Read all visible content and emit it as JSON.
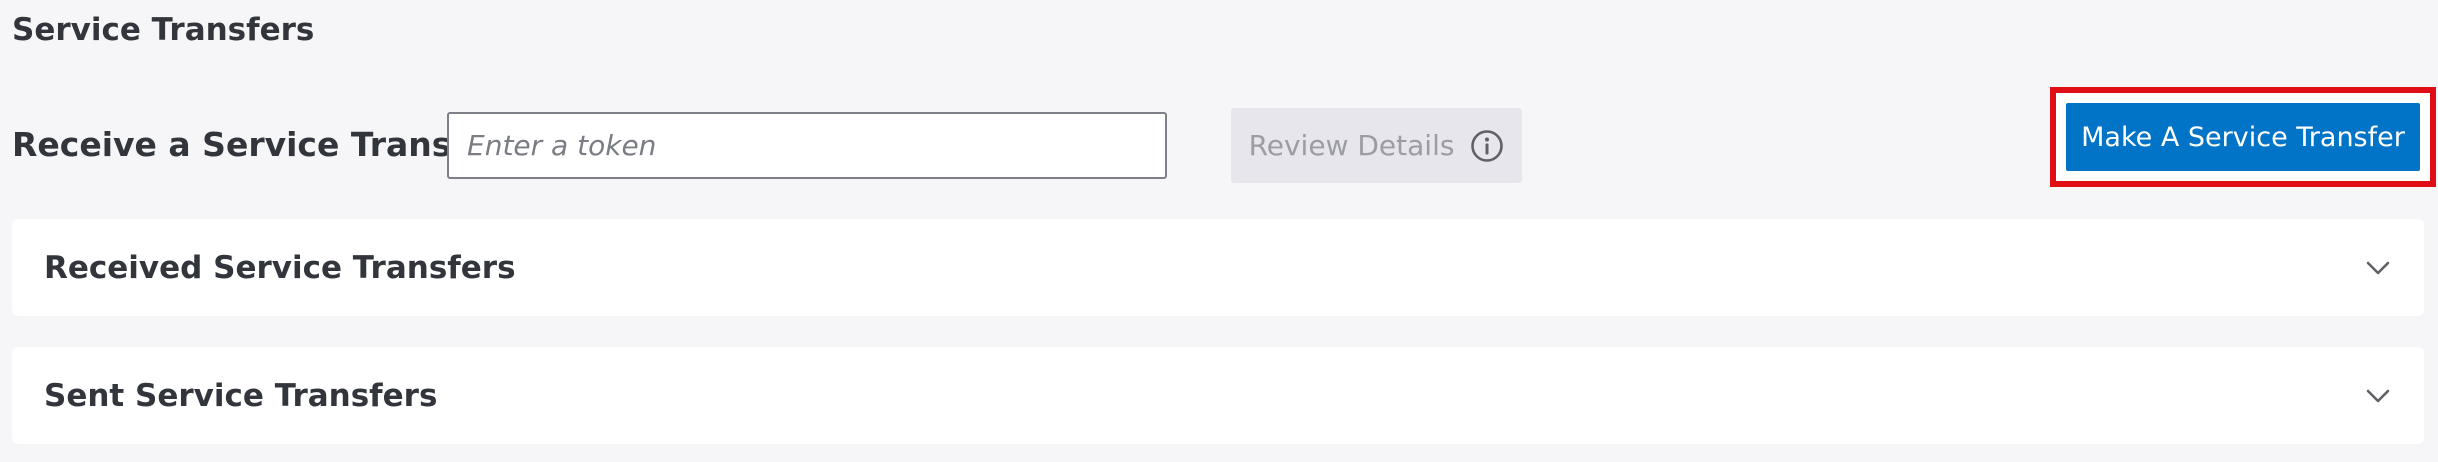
{
  "page": {
    "title": "Service Transfers"
  },
  "receive": {
    "label": "Receive a Service Transfer",
    "input_value": "",
    "input_placeholder": "Enter a token",
    "review_button_label": "Review Details",
    "review_button_icon": "info-icon"
  },
  "make": {
    "button_label": "Make A Service Transfer",
    "accent_color": "#0174c8",
    "highlight_color": "#e00d14"
  },
  "panels": [
    {
      "title": "Received Service Transfers",
      "icon": "chevron-down-icon"
    },
    {
      "title": "Sent Service Transfers",
      "icon": "chevron-down-icon"
    }
  ]
}
